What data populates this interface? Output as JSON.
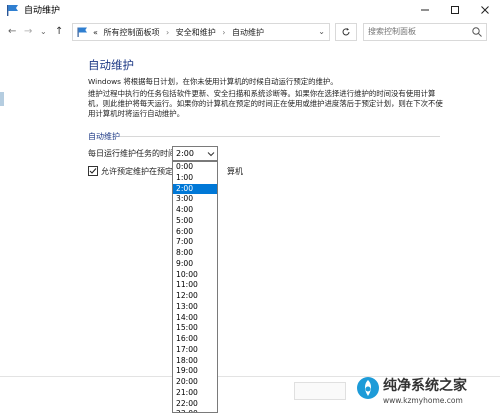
{
  "window": {
    "title": "自动维护"
  },
  "nav": {
    "back": "←",
    "forward": "→",
    "dropdown": "⌄",
    "up": "↑"
  },
  "address": {
    "prefix": "«",
    "crumbs": [
      "所有控制面板项",
      "安全和维护",
      "自动维护"
    ],
    "separator": "›"
  },
  "search": {
    "placeholder": "搜索控制面板"
  },
  "page": {
    "heading": "自动维护",
    "para1": "Windows 将根据每日计划，在你未使用计算机的时候自动运行预定的维护。",
    "para2": "维护过程中执行的任务包括软件更新、安全扫描和系统诊断等。如果你在选择进行维护的时间没有使用计算机，则此维护将每天运行。如果你的计算机在预定的时间正在使用或维护进度落后于预定计划，则在下次不使用计算机时将运行自动维护。",
    "section": "自动维护",
    "time_label": "每日运行维护任务的时间",
    "time_value": "2:00",
    "checkbox_label_left": "允许预定维护在预定时",
    "checkbox_label_right": "算机",
    "checkbox_checked": true
  },
  "time_options": [
    "0:00",
    "1:00",
    "2:00",
    "3:00",
    "4:00",
    "5:00",
    "6:00",
    "7:00",
    "8:00",
    "9:00",
    "10:00",
    "11:00",
    "12:00",
    "13:00",
    "14:00",
    "15:00",
    "16:00",
    "17:00",
    "18:00",
    "19:00",
    "20:00",
    "21:00",
    "22:00",
    "23:00"
  ],
  "selected_option": "2:00",
  "watermark": {
    "title": "纯净系统之家",
    "url": "www.kzmyhome.com"
  },
  "colors": {
    "accent": "#0078d7",
    "heading": "#1e3a86"
  }
}
